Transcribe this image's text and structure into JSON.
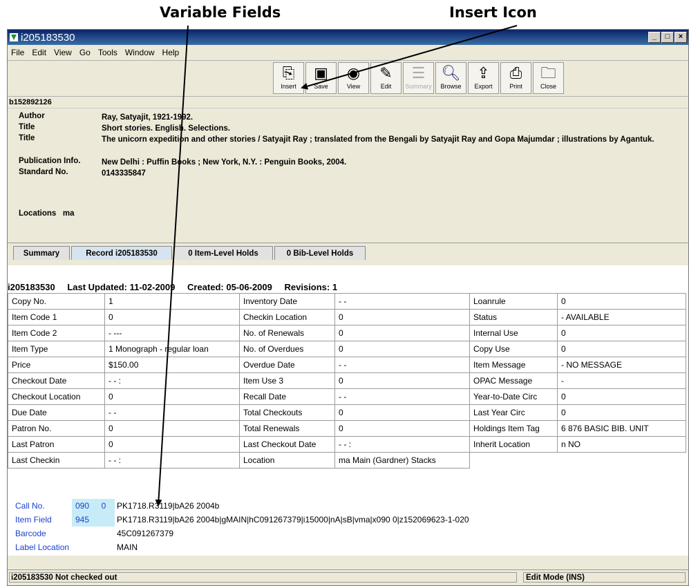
{
  "callouts": {
    "variable_fields": "Variable Fields",
    "insert_icon": "Insert Icon"
  },
  "window": {
    "title": "i205183530"
  },
  "menu": [
    "File",
    "Edit",
    "View",
    "Go",
    "Tools",
    "Window",
    "Help"
  ],
  "toolbar": {
    "insert": "Insert",
    "save": "Save",
    "view": "View",
    "edit": "Edit",
    "summary": "Summary",
    "browse": "Browse",
    "export": "Export",
    "print": "Print",
    "close": "Close"
  },
  "bib": {
    "number": "b152892126",
    "author_label": "Author",
    "author": "Ray, Satyajit, 1921-1992.",
    "title_label": "Title",
    "title1": "Short stories. English. Selections.",
    "title2": "The unicorn expedition and other stories / Satyajit Ray ; translated from the Bengali by Satyajit Ray and Gopa Majumdar ; illustrations by Agantuk.",
    "pub_label": "Publication Info.",
    "pub": "New Delhi : Puffin Books ; New York, N.Y. : Penguin Books, 2004.",
    "std_label": "Standard No.",
    "std": "0143335847",
    "locations_label": "Locations",
    "locations": "ma"
  },
  "tabs": [
    "Summary",
    "Record i205183530",
    "0 Item-Level Holds",
    "0 Bib-Level Holds"
  ],
  "record_header": {
    "id": "i205183530",
    "last_updated": "Last Updated: 11-02-2009",
    "created": "Created: 05-06-2009",
    "revisions": "Revisions: 1"
  },
  "fixed_fields": [
    [
      "Copy No.",
      "1",
      "Inventory Date",
      "- -",
      "Loanrule",
      "0"
    ],
    [
      "Item Code 1",
      "0",
      "Checkin Location",
      "0",
      "Status",
      "-  AVAILABLE"
    ],
    [
      "Item Code 2",
      "-  ---",
      "No. of Renewals",
      "0",
      "Internal Use",
      "0"
    ],
    [
      "Item Type",
      "1  Monograph - regular loan",
      "No. of Overdues",
      "0",
      "Copy Use",
      "0"
    ],
    [
      "Price",
      "$150.00",
      "Overdue Date",
      "- -",
      "Item Message",
      "-  NO MESSAGE"
    ],
    [
      "Checkout Date",
      "- -        :",
      "Item Use 3",
      "0",
      "OPAC Message",
      "-"
    ],
    [
      "Checkout Location",
      "0",
      "Recall Date",
      "- -",
      "Year-to-Date Circ",
      "0"
    ],
    [
      "Due Date",
      "- -",
      "Total Checkouts",
      "0",
      "Last Year Circ",
      "0"
    ],
    [
      "Patron No.",
      "0",
      "Total Renewals",
      "0",
      "Holdings Item Tag",
      "6  876 BASIC BIB. UNIT"
    ],
    [
      "Last Patron",
      "0",
      "Last Checkout Date",
      "- -        :",
      "Inherit Location",
      "n  NO"
    ],
    [
      "Last Checkin",
      "- -        :",
      "Location",
      "ma      Main (Gardner) Stacks",
      "",
      ""
    ]
  ],
  "variable_fields": [
    {
      "label": "Call No.",
      "tag": "090",
      "ind": "0",
      "value": "PK1718.R3119|bA26 2004b"
    },
    {
      "label": "Item Field",
      "tag": "945",
      "ind": "",
      "value": "PK1718.R3119|bA26 2004b|gMAIN|hC091267379|i15000|nA|sB|vma|x090 0|z152069623-1-020"
    },
    {
      "label": "Barcode",
      "tag": "",
      "ind": "",
      "value": "45C091267379"
    },
    {
      "label": "Label Location",
      "tag": "",
      "ind": "",
      "value": "MAIN"
    }
  ],
  "status": {
    "left": "i205183530  Not checked out",
    "right": "Edit Mode (INS)"
  },
  "colors": {
    "titlebar": "#0a246a",
    "field_label": "#1a3fd0",
    "tag_highlight": "#c8ecf7",
    "tab_active": "#d6e4ef"
  }
}
